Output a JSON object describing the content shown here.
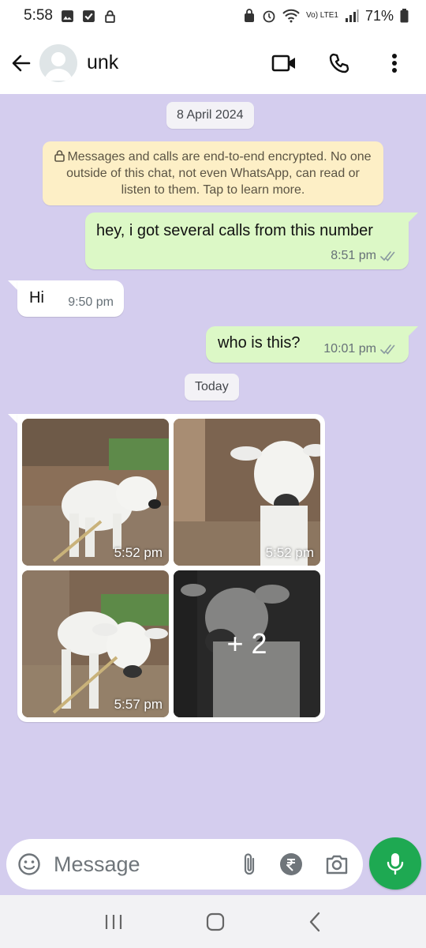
{
  "status_bar": {
    "time": "5:58",
    "network": "Vo) LTE1",
    "battery": "71%"
  },
  "header": {
    "contact_name": "unk"
  },
  "chat": {
    "date_chip_1": "8 April 2024",
    "encryption_notice": "Messages and calls are end-to-end encrypted. No one outside of this chat, not even WhatsApp, can read or listen to them. Tap to learn more.",
    "messages": [
      {
        "direction": "outgoing",
        "text": "hey, i got several calls from this number",
        "time": "8:51 pm",
        "status": "read"
      },
      {
        "direction": "incoming",
        "text": "Hi",
        "time": "9:50 pm"
      },
      {
        "direction": "outgoing",
        "text": "who is this?",
        "time": "10:01 pm",
        "status": "read"
      }
    ],
    "date_chip_2": "Today",
    "media_group": {
      "times": [
        "5:52 pm",
        "5:52 pm",
        "5:57 pm"
      ],
      "more_count": "+ 2"
    }
  },
  "composer": {
    "placeholder": "Message"
  },
  "colors": {
    "wallpaper": "#d4cdee",
    "outgoing": "#dcf8c6",
    "incoming": "#ffffff",
    "accent": "#1ea952"
  }
}
